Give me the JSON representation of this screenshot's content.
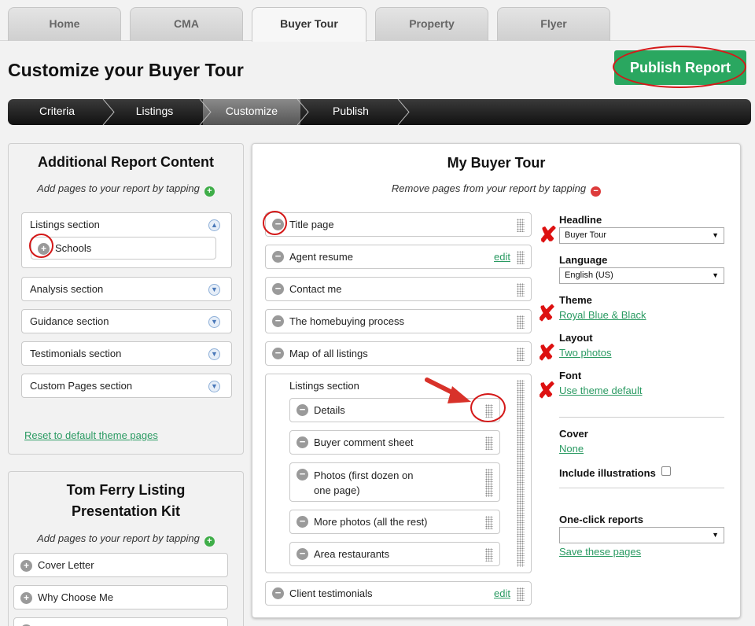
{
  "tabs": [
    "Home",
    "CMA",
    "Buyer Tour",
    "Property",
    "Flyer"
  ],
  "page_title": "Customize your Buyer Tour",
  "publish_label": "Publish Report",
  "steps": [
    "Criteria",
    "Listings",
    "Customize",
    "Publish"
  ],
  "left_panel": {
    "title": "Additional Report Content",
    "hint": "Add pages to your report by tapping",
    "listings_section": "Listings section",
    "schools": "Schools",
    "sections": [
      "Analysis section",
      "Guidance section",
      "Testimonials section",
      "Custom Pages section"
    ],
    "reset_link": "Reset to default theme pages"
  },
  "kit_panel": {
    "title_line1": "Tom Ferry Listing",
    "title_line2": "Presentation Kit",
    "hint": "Add pages to your report by tapping",
    "items": [
      "Cover Letter",
      "Why Choose Me"
    ]
  },
  "main_panel": {
    "title": "My Buyer Tour",
    "hint": "Remove pages from your report by tapping",
    "pages": {
      "title_page": "Title page",
      "agent_resume": "Agent resume",
      "contact_me": "Contact me",
      "homebuying": "The homebuying process",
      "map": "Map of all listings",
      "client_testimonials": "Client testimonials"
    },
    "edit_label": "edit",
    "listings_section": "Listings section",
    "listing_pages": {
      "details": "Details",
      "buyer_comment": "Buyer comment sheet",
      "photos_line1": "Photos (first dozen on",
      "photos_line2": "one page)",
      "more_photos": "More photos (all the rest)",
      "restaurants": "Area restaurants"
    }
  },
  "settings": {
    "headline_label": "Headline",
    "headline_value": "Buyer Tour",
    "language_label": "Language",
    "language_value": "English (US)",
    "theme_label": "Theme",
    "theme_value": "Royal Blue & Black",
    "layout_label": "Layout",
    "layout_value": "Two photos",
    "font_label": "Font",
    "font_value": "Use theme default",
    "cover_label": "Cover",
    "cover_value": "None",
    "illustrations_label": "Include illustrations",
    "oneclick_label": "One-click reports",
    "oneclick_value": "",
    "save_link": "Save these pages"
  },
  "colors": {
    "accent_green": "#2aa760",
    "link_green": "#2a9a62",
    "annotation_red": "#d41818"
  }
}
